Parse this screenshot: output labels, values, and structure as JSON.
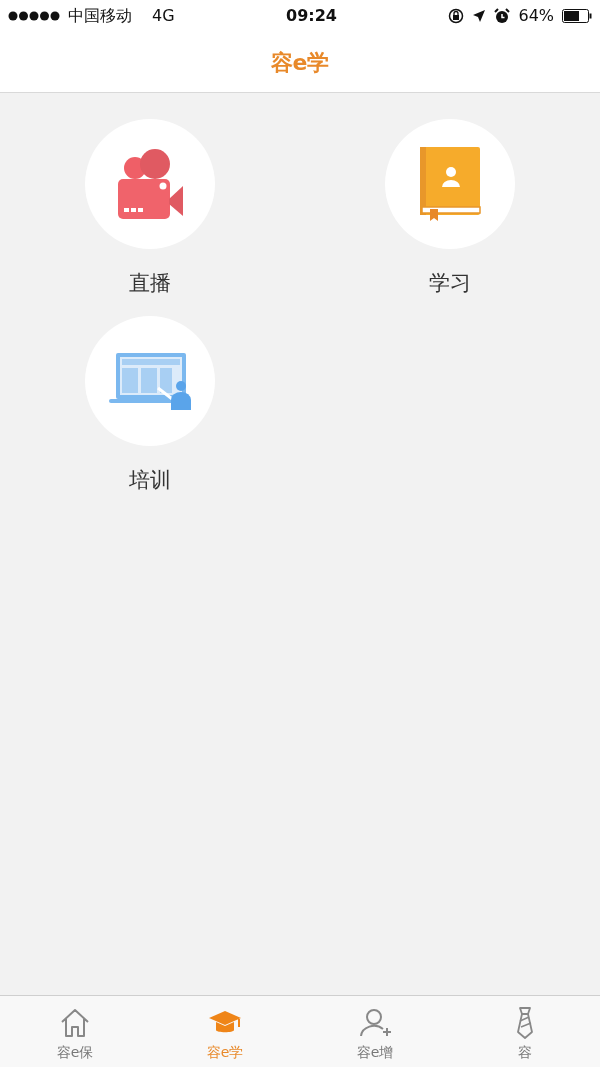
{
  "status_bar": {
    "carrier": "中国移动",
    "network": "4G",
    "time": "09:24",
    "battery": "64%"
  },
  "header": {
    "title": "容e学"
  },
  "features": [
    {
      "label": "直播",
      "kind": "camera"
    },
    {
      "label": "学习",
      "kind": "book"
    },
    {
      "label": "培训",
      "kind": "training"
    }
  ],
  "tab_bar": [
    {
      "label": "容e保",
      "kind": "home",
      "selected": false
    },
    {
      "label": "容e学",
      "kind": "cap",
      "selected": true
    },
    {
      "label": "容e增",
      "kind": "user-add",
      "selected": false
    },
    {
      "label": "容",
      "kind": "tie",
      "selected": false
    }
  ]
}
